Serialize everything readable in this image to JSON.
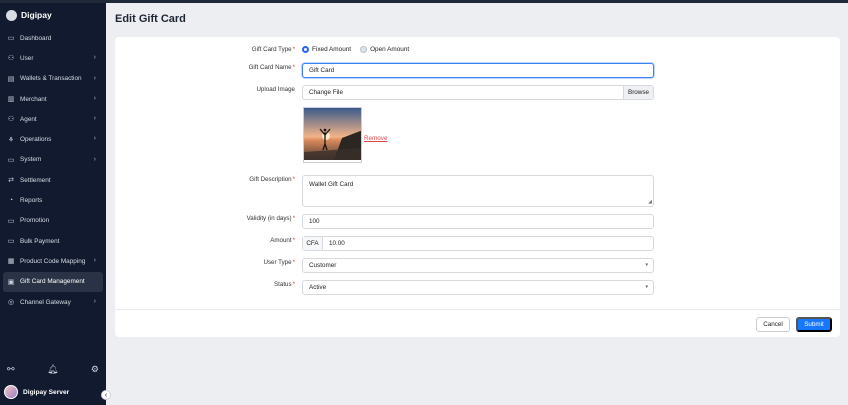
{
  "app": {
    "brand": "Digipay"
  },
  "sidebar": {
    "items": [
      {
        "label": "Dashboard",
        "icon": "home-icon",
        "chev": false
      },
      {
        "label": "User",
        "icon": "user-icon",
        "chev": true
      },
      {
        "label": "Wallets & Transaction",
        "icon": "wallet-icon",
        "chev": true
      },
      {
        "label": "Merchant",
        "icon": "store-icon",
        "chev": true
      },
      {
        "label": "Agent",
        "icon": "agent-icon",
        "chev": true
      },
      {
        "label": "Operations",
        "icon": "operations-icon",
        "chev": true
      },
      {
        "label": "System",
        "icon": "monitor-icon",
        "chev": true
      },
      {
        "label": "Settlement",
        "icon": "transfer-icon",
        "chev": false
      },
      {
        "label": "Reports",
        "icon": "reports-icon",
        "chev": false
      },
      {
        "label": "Promotion",
        "icon": "promotion-icon",
        "chev": false
      },
      {
        "label": "Bulk Payment",
        "icon": "bulk-payment-icon",
        "chev": false
      },
      {
        "label": "Product Code Mapping",
        "icon": "mapping-icon",
        "chev": true
      },
      {
        "label": "Gift Card Management",
        "icon": "gift-icon",
        "chev": false
      },
      {
        "label": "Channel Gateway",
        "icon": "gateway-icon",
        "chev": true
      }
    ],
    "active_index": 12,
    "user_name": "Digipay Server"
  },
  "page": {
    "title": "Edit Gift Card"
  },
  "form": {
    "type_label": "Gift Card Type",
    "type_options": [
      "Fixed Amount",
      "Open Amount"
    ],
    "name_label": "Gift Card Name",
    "name_value": "Gift Card",
    "upload_label": "Upload Image",
    "upload_text": "Change File",
    "browse_label": "Browse",
    "remove_label": "Remove",
    "description_label": "Gift Description",
    "description_value": "Wallet Gift Card",
    "validity_label": "Validity (in days)",
    "validity_value": "100",
    "amount_label": "Amount",
    "amount_prefix": "CFA",
    "amount_value": "10.00",
    "user_type_label": "User Type",
    "user_type_value": "Customer",
    "status_label": "Status",
    "status_value": "Active",
    "cancel_label": "Cancel",
    "submit_label": "Submit"
  },
  "colors": {
    "sidebar_bg": "#111a2e",
    "primary": "#1677ff",
    "remove": "#e04848"
  }
}
